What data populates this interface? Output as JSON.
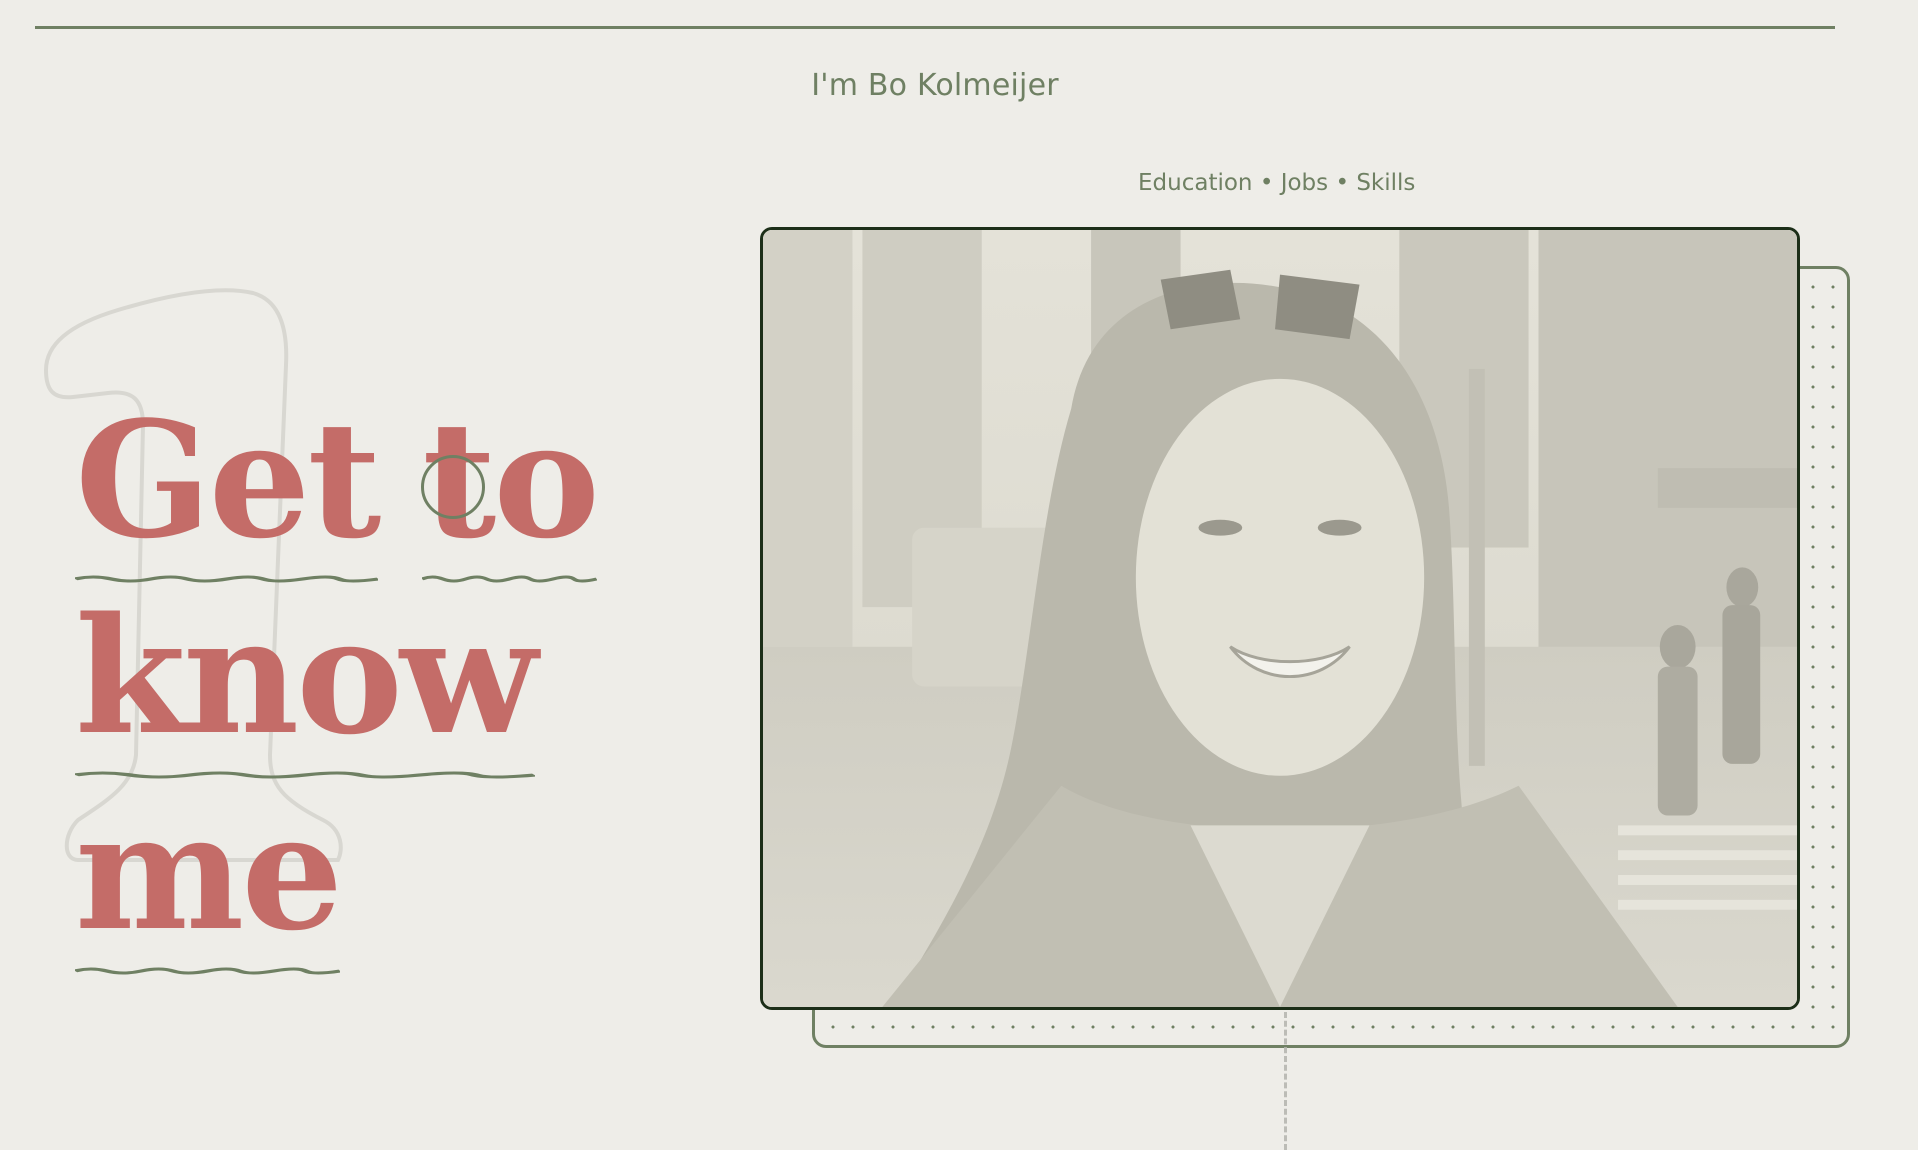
{
  "header": {
    "site_name": "I'm Bo Kolmeijer"
  },
  "breadcrumb": {
    "text": "Education • Jobs • Skills"
  },
  "hero": {
    "section_number": "1",
    "headline_words": [
      "Get",
      "to",
      "know",
      "me"
    ]
  },
  "photo": {
    "alt": "Portrait photo of Bo Kolmeijer on a city street"
  },
  "colors": {
    "background": "#eeede8",
    "accent_green": "#6f8063",
    "headline_coral": "#c46c68",
    "frame_dark": "#1c2e18"
  }
}
